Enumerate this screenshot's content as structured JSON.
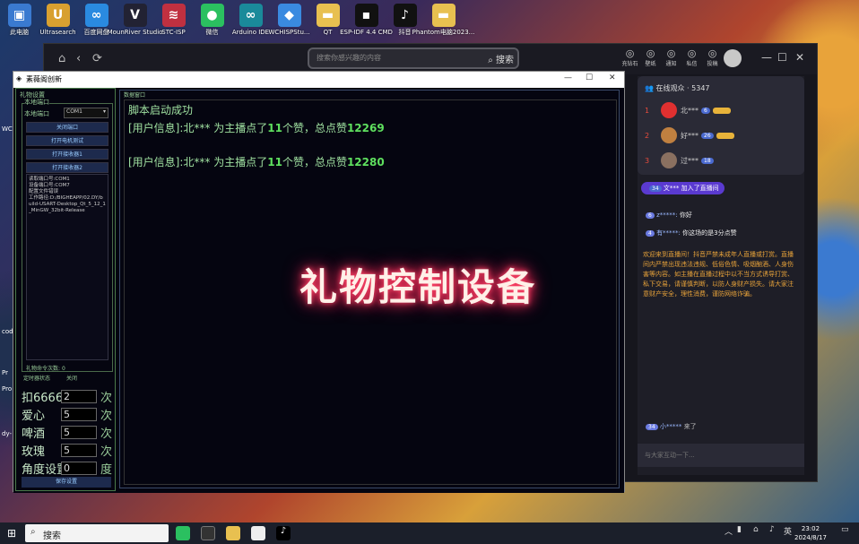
{
  "desktop": {
    "icons": [
      {
        "label": "此电脑",
        "icon": "computer-icon",
        "color": "#3a7ad0",
        "glyph": "▣"
      },
      {
        "label": "Ultrasearch",
        "icon": "ultrasearch-icon",
        "color": "#d8a030",
        "glyph": "U"
      },
      {
        "label": "百度网盘",
        "icon": "baidu-netdisk-icon",
        "color": "#2a8ae0",
        "glyph": "∞"
      },
      {
        "label": "MounRiver Studio",
        "icon": "mounriver-icon",
        "color": "#223",
        "glyph": "V"
      },
      {
        "label": "STC-ISP",
        "icon": "stc-isp-icon",
        "color": "#c03040",
        "glyph": "≋"
      },
      {
        "label": "微信",
        "icon": "wechat-icon",
        "color": "#2bc060",
        "glyph": "●"
      },
      {
        "label": "Arduino IDE",
        "icon": "arduino-icon",
        "color": "#1a8a9a",
        "glyph": "∞"
      },
      {
        "label": "WCHISPStu...",
        "icon": "wchisp-icon",
        "color": "#3a8ae0",
        "glyph": "◆"
      },
      {
        "label": "QT",
        "icon": "folder-icon",
        "color": "#e8c050",
        "glyph": "▬"
      },
      {
        "label": "ESP-IDF 4.4 CMD",
        "icon": "esp-idf-icon",
        "color": "#111",
        "glyph": "▪"
      },
      {
        "label": "抖音",
        "icon": "douyin-icon",
        "color": "#111",
        "glyph": "♪"
      },
      {
        "label": "Phantom电脑2023...",
        "icon": "folder-icon",
        "color": "#e8c050",
        "glyph": "▬"
      }
    ],
    "side_labels": [
      "WC",
      "cod",
      "Pr",
      "Pro",
      "dy-"
    ]
  },
  "browser": {
    "search_placeholder": "搜索你感兴趣的内容",
    "search_button": "搜索",
    "tools": [
      {
        "label": "充钻石",
        "icon": "diamond-icon"
      },
      {
        "label": "壁纸",
        "icon": "wallpaper-icon"
      },
      {
        "label": "通知",
        "icon": "bell-icon"
      },
      {
        "label": "私信",
        "icon": "message-icon"
      },
      {
        "label": "投稿",
        "icon": "upload-icon"
      }
    ],
    "online_label": "在线观众",
    "online_count": "5347",
    "viewers": [
      {
        "rank": "1",
        "name": "北***",
        "level": "6",
        "color": "#e03030"
      },
      {
        "rank": "2",
        "name": "好***",
        "level": "26",
        "color": "#c08040"
      },
      {
        "rank": "3",
        "name": "过***",
        "level": "18",
        "color": "#8a7060"
      }
    ],
    "join_notice": {
      "level": "34",
      "text": "文*** 加入了直播间"
    },
    "chat": [
      {
        "level": "6",
        "name": "z*****:",
        "text": "你好"
      },
      {
        "level": "4",
        "name": "有*****:",
        "text": "你这场的是3分点赞"
      }
    ],
    "notice": "欢迎来到直播间！抖音严禁未成年人直播或打赏。直播间内严禁出现违法违规、低俗色情、吸烟酗酒、人身伤害等内容。如主播在直播过程中以不当方式诱导打赏、私下交易，请谨慎判断，以防人身财产损失。请大家注意财产安全，理性消费，谨防网络诈骗。",
    "last_join": {
      "level": "34",
      "name": "小*****",
      "text": "来了"
    },
    "comment_placeholder": "与大家互动一下..."
  },
  "tool": {
    "title": "素薇阁创新",
    "gift_settings_label": "礼物设置",
    "port_group_label": "本地端口",
    "port_label": "本地端口",
    "port_value": "COM1",
    "buttons": [
      "关闭端口",
      "打开电机测试",
      "打开接收器1",
      "打开接收器2"
    ],
    "log": "读取端口号:COM1\n设备端口号:COM7\n配置文件错误\n工作路径:D:/BIGHEAPP/02.DY/build-USART-Desktop_Qt_5_12_1_MinGW_32bit-Release",
    "cmd_count_label": "礼物命令次数:",
    "cmd_count": "0",
    "timer_label": "定时器状态",
    "timer_value": "关闭",
    "gifts": [
      {
        "label": "扣6666",
        "value": "2",
        "unit": "次"
      },
      {
        "label": "爱心",
        "value": "5",
        "unit": "次"
      },
      {
        "label": "啤酒",
        "value": "5",
        "unit": "次"
      },
      {
        "label": "玫瑰",
        "value": "5",
        "unit": "次"
      },
      {
        "label": "角度设置",
        "value": "0",
        "unit": "度"
      }
    ],
    "save_label": "保存设置",
    "data_window_label": "数据窗口",
    "data_lines": [
      {
        "prefix": "脚本启动成功",
        "bold1": "",
        "mid": "",
        "bold2": ""
      },
      {
        "prefix": "[用户信息]:北*** 为主播点了",
        "bold1": "11",
        "mid": "个赞，总点赞",
        "bold2": "12269"
      },
      {
        "prefix": "[用户信息]:北*** 为主播点了",
        "bold1": "11",
        "mid": "个赞，总点赞",
        "bold2": "12280"
      }
    ],
    "overlay_text": "礼物控制设备"
  },
  "taskbar": {
    "search_label": "搜索",
    "time": "23:02",
    "date": "2024/8/17",
    "ime": "英"
  }
}
